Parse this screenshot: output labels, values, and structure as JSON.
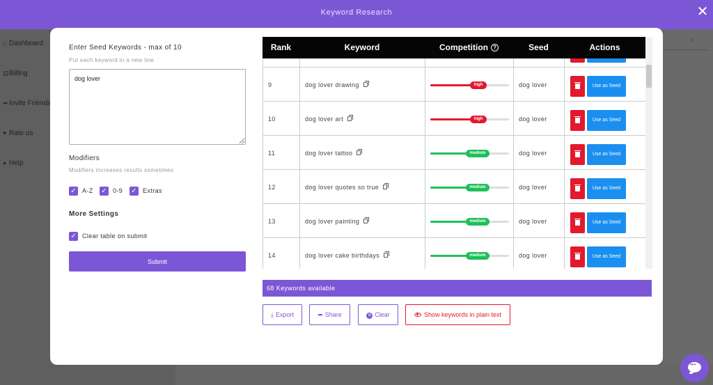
{
  "modal": {
    "title": "Keyword Research"
  },
  "background": {
    "sidebar": [
      {
        "label": "Dashboard",
        "icon": "home-icon",
        "glyph": "⌂"
      },
      {
        "label": "Billing",
        "icon": "billing-icon",
        "glyph": "▤"
      },
      {
        "label": "Invite Friends",
        "icon": "share-icon",
        "glyph": "➦"
      },
      {
        "label": "Rate us",
        "icon": "heart-icon",
        "glyph": "♥"
      },
      {
        "label": "Help",
        "icon": "help-icon",
        "glyph": "●"
      }
    ]
  },
  "form": {
    "seed_label": "Enter Seed Keywords - max of 10",
    "seed_hint": "Put each keyword in a new line",
    "seed_value": "dog lover",
    "modifiers_label": "Modifiers",
    "modifiers_hint": "Modifiers increases results sometimes",
    "modifiers": [
      {
        "label": "A-Z",
        "checked": true
      },
      {
        "label": "0-9",
        "checked": true
      },
      {
        "label": "Extras",
        "checked": true
      }
    ],
    "more_settings_label": "More Settings",
    "clear_table_label": "Clear table on submit",
    "clear_table_checked": true,
    "submit_label": "Submit"
  },
  "table": {
    "headers": {
      "rank": "Rank",
      "keyword": "Keyword",
      "competition": "Competition",
      "seed": "Seed",
      "actions": "Actions"
    },
    "use_as_seed_label": "Use as Seed",
    "colors": {
      "high": "#e3192d",
      "medium": "#1fbf5a"
    },
    "rows": [
      {
        "rank": "",
        "keyword": "",
        "competition": "",
        "level": 0,
        "seed": ""
      },
      {
        "rank": "9",
        "keyword": "dog lover drawing",
        "competition": "high",
        "level": 0.72,
        "seed": "dog lover"
      },
      {
        "rank": "10",
        "keyword": "dog lover art",
        "competition": "high",
        "level": 0.72,
        "seed": "dog lover"
      },
      {
        "rank": "11",
        "keyword": "dog lover tattoo",
        "competition": "medium",
        "level": 0.66,
        "seed": "dog lover"
      },
      {
        "rank": "12",
        "keyword": "dog lover quotes so true",
        "competition": "medium",
        "level": 0.66,
        "seed": "dog lover"
      },
      {
        "rank": "13",
        "keyword": "dog lover painting",
        "competition": "medium",
        "level": 0.66,
        "seed": "dog lover"
      },
      {
        "rank": "14",
        "keyword": "dog lover cake birthdays",
        "competition": "medium",
        "level": 0.66,
        "seed": "dog lover"
      }
    ]
  },
  "summary": {
    "keywords_available": "68 Keywords available"
  },
  "actions": {
    "export_label": "Export",
    "share_label": "Share",
    "clear_label": "Clear",
    "plain_text_label": "Show keywords in plain text"
  }
}
